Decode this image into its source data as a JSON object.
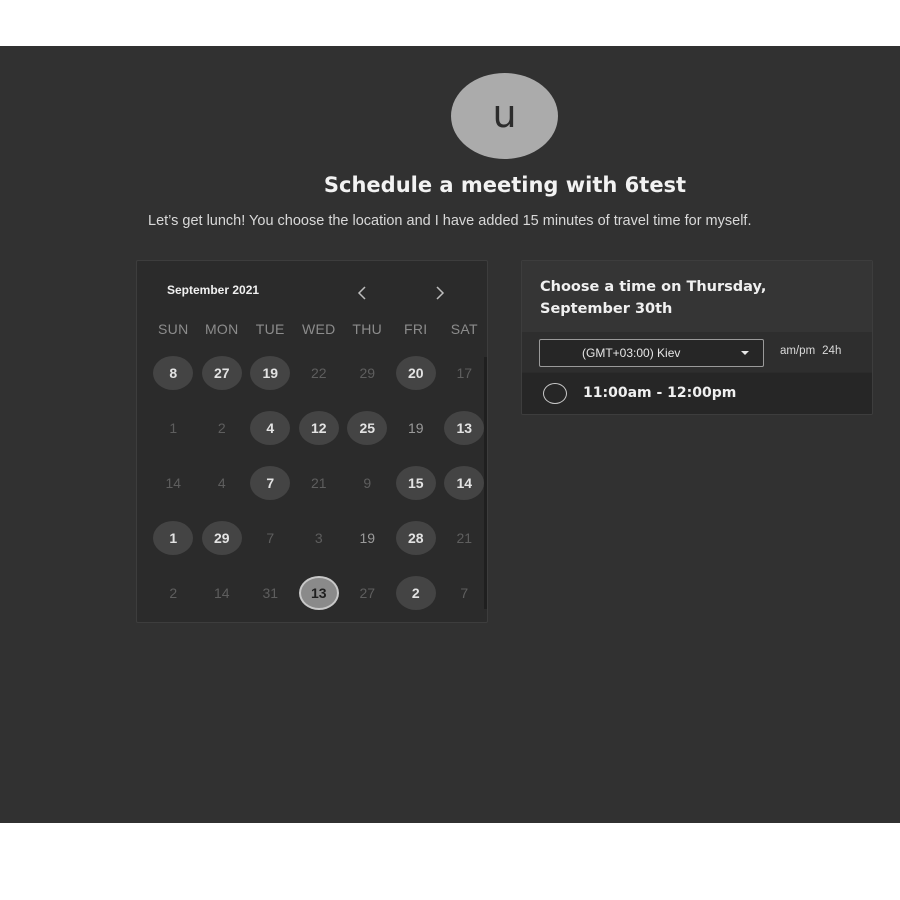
{
  "host": {
    "avatar_initial": "u",
    "title": "Schedule a meeting with 6test",
    "description": "Let’s get lunch! You choose the location and I have added 15 minutes of travel time for myself."
  },
  "calendar": {
    "month_label": "September 2021",
    "prev_icon": "chevron-left-icon",
    "next_icon": "chevron-right-icon",
    "weekdays": [
      "SUN",
      "MON",
      "TUE",
      "WED",
      "THU",
      "FRI",
      "SAT"
    ],
    "weeks": [
      [
        {
          "label": "8",
          "state": "available"
        },
        {
          "label": "27",
          "state": "available"
        },
        {
          "label": "19",
          "state": "available"
        },
        {
          "label": "22",
          "state": "disabled"
        },
        {
          "label": "29",
          "state": "disabled"
        },
        {
          "label": "20",
          "state": "available"
        },
        {
          "label": "17",
          "state": "disabled"
        }
      ],
      [
        {
          "label": "1",
          "state": "disabled"
        },
        {
          "label": "2",
          "state": "disabled"
        },
        {
          "label": "4",
          "state": "available"
        },
        {
          "label": "12",
          "state": "available"
        },
        {
          "label": "25",
          "state": "available"
        },
        {
          "label": "19",
          "state": "light"
        },
        {
          "label": "13",
          "state": "available"
        }
      ],
      [
        {
          "label": "14",
          "state": "disabled"
        },
        {
          "label": "4",
          "state": "disabled"
        },
        {
          "label": "7",
          "state": "available"
        },
        {
          "label": "21",
          "state": "disabled"
        },
        {
          "label": "9",
          "state": "disabled"
        },
        {
          "label": "15",
          "state": "available"
        },
        {
          "label": "14",
          "state": "available"
        }
      ],
      [
        {
          "label": "1",
          "state": "available"
        },
        {
          "label": "29",
          "state": "available"
        },
        {
          "label": "7",
          "state": "disabled"
        },
        {
          "label": "3",
          "state": "disabled"
        },
        {
          "label": "19",
          "state": "light"
        },
        {
          "label": "28",
          "state": "available"
        },
        {
          "label": "21",
          "state": "disabled"
        }
      ],
      [
        {
          "label": "2",
          "state": "disabled"
        },
        {
          "label": "14",
          "state": "disabled"
        },
        {
          "label": "31",
          "state": "disabled"
        },
        {
          "label": "13",
          "state": "selected"
        },
        {
          "label": "27",
          "state": "disabled"
        },
        {
          "label": "2",
          "state": "available"
        },
        {
          "label": "7",
          "state": "disabled"
        }
      ]
    ]
  },
  "time_panel": {
    "heading": "Choose a time on Thursday, September 30th",
    "timezone": "(GMT+03:00) Kiev",
    "format_12h": "am/pm",
    "format_24h": "24h",
    "slots": [
      {
        "label": "11:00am - 12:00pm"
      }
    ]
  },
  "colors": {
    "background": "#313131",
    "panel": "#2b2b2b",
    "available_day": "#444444",
    "selected_day": "#8a8a8a"
  }
}
